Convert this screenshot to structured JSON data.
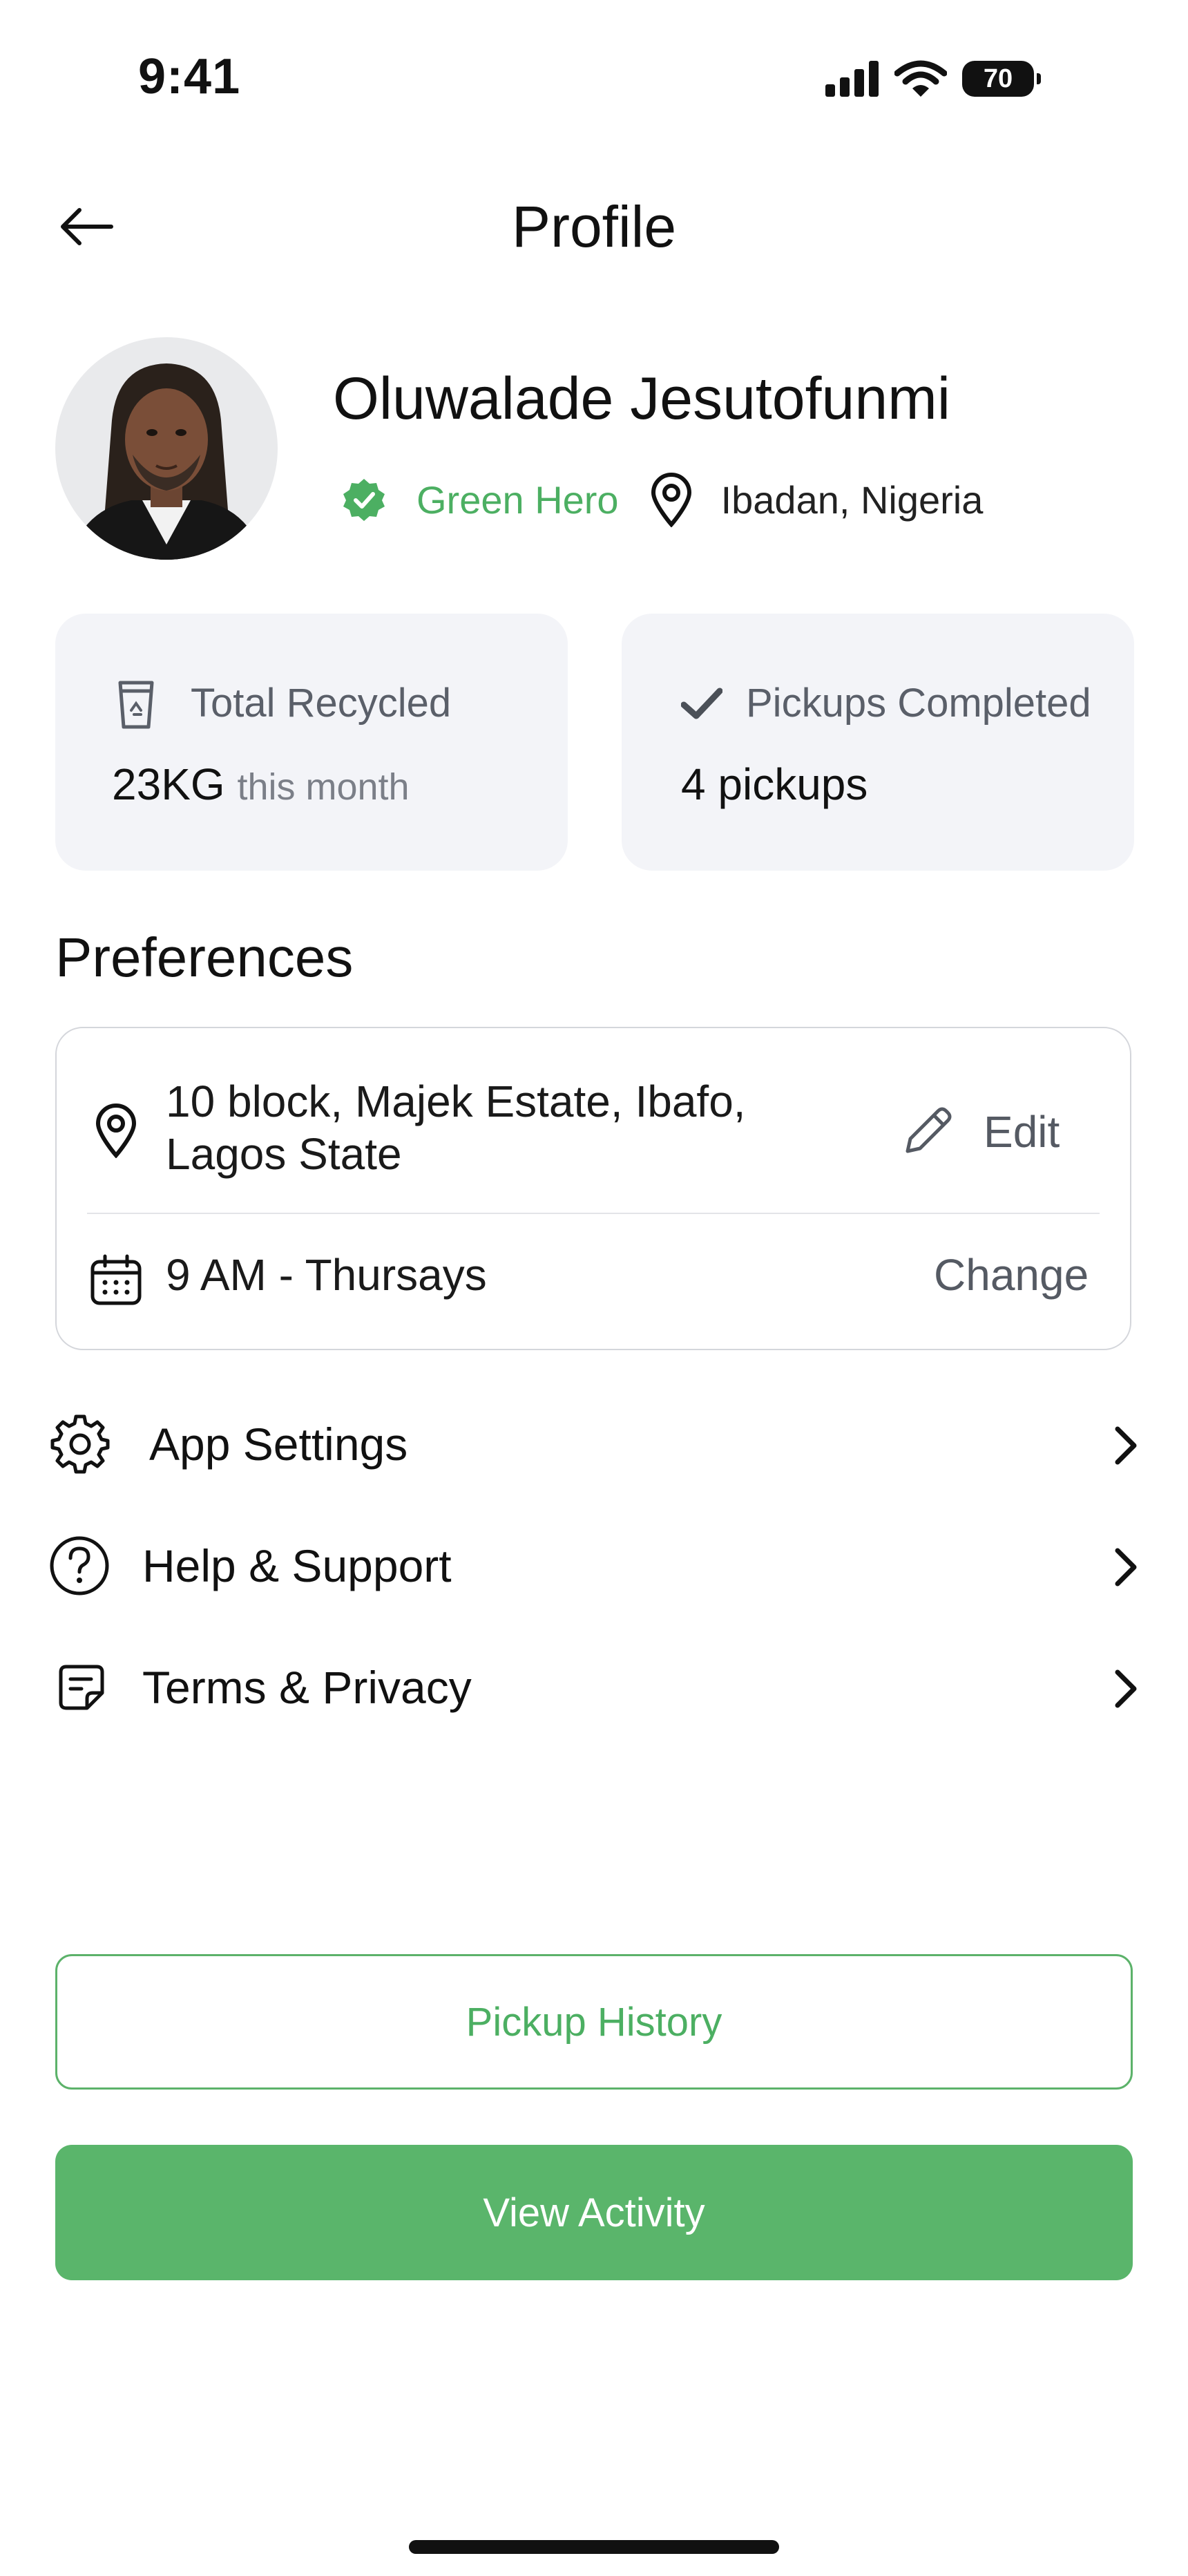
{
  "status_bar": {
    "time": "9:41",
    "battery": "70"
  },
  "header": {
    "title": "Profile"
  },
  "profile": {
    "name": "Oluwalade Jesutofunmi",
    "badge": "Green Hero",
    "location": "Ibadan, Nigeria"
  },
  "stats": {
    "recycled": {
      "label": "Total Recycled",
      "value": "23KG",
      "sub": "this month"
    },
    "pickups": {
      "label": "Pickups Completed",
      "value": "4 pickups"
    }
  },
  "preferences": {
    "title": "Preferences",
    "address": "10 block, Majek Estate, Ibafo, Lagos State",
    "edit_label": "Edit",
    "schedule": "9 AM - Thursays",
    "change_label": "Change"
  },
  "menu": [
    {
      "label": "App Settings",
      "icon": "gear-icon"
    },
    {
      "label": "Help & Support",
      "icon": "help-circle-icon"
    },
    {
      "label": "Terms & Privacy",
      "icon": "document-icon"
    }
  ],
  "buttons": {
    "history": "Pickup History",
    "activity": "View Activity"
  },
  "colors": {
    "accent": "#5ab56b",
    "accent_text": "#4caf62",
    "card_bg": "#f3f4f8"
  }
}
